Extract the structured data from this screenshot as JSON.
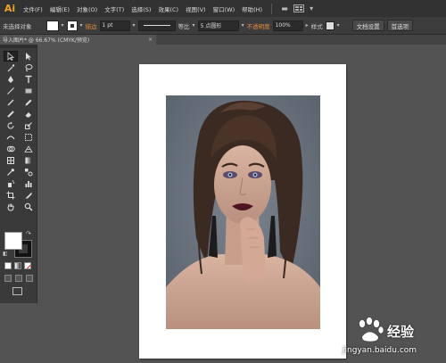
{
  "app": {
    "logo": "Ai"
  },
  "menu": {
    "items": [
      "文件(F)",
      "编辑(E)",
      "对象(O)",
      "文字(T)",
      "选择(S)",
      "效果(C)",
      "视图(V)",
      "窗口(W)",
      "帮助(H)"
    ]
  },
  "control_bar": {
    "selection_label": "未选择对象",
    "stroke_label": "描边",
    "stroke_weight": "1 pt",
    "profile_label": "等比",
    "brush_label": "5 点圆形",
    "opacity_label": "不透明度",
    "opacity_value": "100%",
    "style_label": "样式",
    "doc_setup_button": "文档设置",
    "preferences_button": "首选项"
  },
  "document_tab": {
    "title": "导入图片* @ 66.67% (CMYK/预览)",
    "close": "×"
  },
  "tools": [
    "selection-tool",
    "direct-selection-tool",
    "magic-wand-tool",
    "lasso-tool",
    "pen-tool",
    "type-tool",
    "line-tool",
    "rectangle-tool",
    "paintbrush-tool",
    "pencil-tool",
    "blob-brush-tool",
    "eraser-tool",
    "rotate-tool",
    "scale-tool",
    "width-tool",
    "free-transform-tool",
    "shape-builder-tool",
    "perspective-grid-tool",
    "mesh-tool",
    "gradient-tool",
    "eyedropper-tool",
    "blend-tool",
    "symbol-sprayer-tool",
    "column-graph-tool",
    "artboard-tool",
    "slice-tool",
    "hand-tool",
    "zoom-tool"
  ],
  "watermark": {
    "title": "经验",
    "url": "jingyan.baidu.com"
  },
  "colors": {
    "accent": "#e08c3a",
    "logo": "#f0a12a",
    "canvas_bg": "#535353",
    "photo_bg": "#646d79"
  }
}
